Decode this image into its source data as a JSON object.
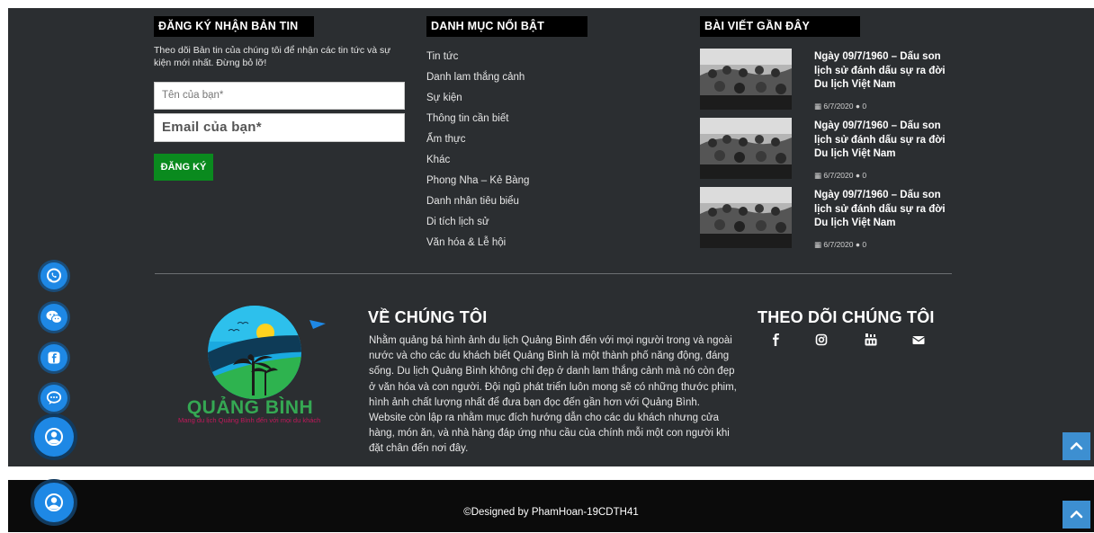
{
  "newsletter": {
    "heading": "ĐĂNG KÝ NHẬN BẢN TIN",
    "description": "Theo dõi Bản tin của chúng tôi để nhận các tin tức và sự kiện mới nhất. Đừng bỏ lỡ!",
    "name_placeholder": "Tên của bạn*",
    "email_placeholder": "Email của bạn*",
    "submit_label": "ĐĂNG KÝ"
  },
  "categories": {
    "heading": "DANH MỤC NỔI BẬT",
    "items": [
      {
        "label": "Tin tức"
      },
      {
        "label": "Danh lam thắng cảnh"
      },
      {
        "label": "Sự kiện"
      },
      {
        "label": "Thông tin cần biết"
      },
      {
        "label": "Ẩm thực"
      },
      {
        "label": "Khác"
      },
      {
        "label": "Phong Nha – Kẻ Bàng"
      },
      {
        "label": "Danh nhân tiêu biểu"
      },
      {
        "label": "Di tích lịch sử"
      },
      {
        "label": "Văn hóa & Lễ hội"
      }
    ]
  },
  "recent_posts": {
    "heading": "BÀI VIẾT GẦN ĐÂY",
    "items": [
      {
        "title": "Ngày 09/7/1960 – Dấu son lịch sử đánh dấu sự ra đời Du lịch Việt Nam",
        "date": "6/7/2020",
        "comments": "0",
        "thumb_icon": "historic-group-photo"
      },
      {
        "title": "Ngày 09/7/1960 – Dấu son lịch sử đánh dấu sự ra đời Du lịch Việt Nam",
        "date": "6/7/2020",
        "comments": "0",
        "thumb_icon": "historic-group-photo"
      },
      {
        "title": "Ngày 09/7/1960 – Dấu son lịch sử đánh dấu sự ra đời Du lịch Việt Nam",
        "date": "6/7/2020",
        "comments": "0",
        "thumb_icon": "historic-group-photo"
      }
    ]
  },
  "about": {
    "title": "VỀ CHÚNG TÔI",
    "text": "Nhằm quảng bá hình ảnh du lịch Quảng Bình đến với mọi người trong và ngoài nước và cho các du khách biết Quảng Bình là một thành phố năng động, đáng sống. Du lịch Quảng Bình không chỉ đẹp ở danh lam thắng cảnh mà nó còn đẹp ở văn hóa và con người. Đội ngũ phát triển luôn mong sẽ có những thước phim, hình ảnh chất lượng nhất để đưa bạn đọc đến gần hơn với Quảng Bình. Website còn lập ra nhằm mục đích hướng dẫn cho các du khách nhưng cửa hàng, món ăn, và nhà hàng đáp ứng nhu cầu của chính mỗi một con người khi đặt chân đến nơi đây."
  },
  "logo": {
    "brand": "QUẢNG BÌNH",
    "tagline": "Mang du lịch Quảng Bình đến với mọi du khách"
  },
  "follow": {
    "title": "THEO DÕI CHÚNG TÔI",
    "icons": [
      "facebook-icon",
      "instagram-icon",
      "youtube-icon",
      "envelope-icon"
    ]
  },
  "floating_contacts": [
    "whatsapp-icon",
    "wechat-icon",
    "facebook-messenger-icon",
    "chat-bubble-icon",
    "user-contact-icon"
  ],
  "footer": {
    "copyright": "©Designed by PhamHoan-19CDTH41"
  },
  "colors": {
    "footer_bg": "#2b2e31",
    "copyright_bg": "#0b0b0b",
    "accent_blue": "#1e88e5",
    "subscribe_green": "#0a8a1e",
    "brand_green": "#35a853"
  }
}
